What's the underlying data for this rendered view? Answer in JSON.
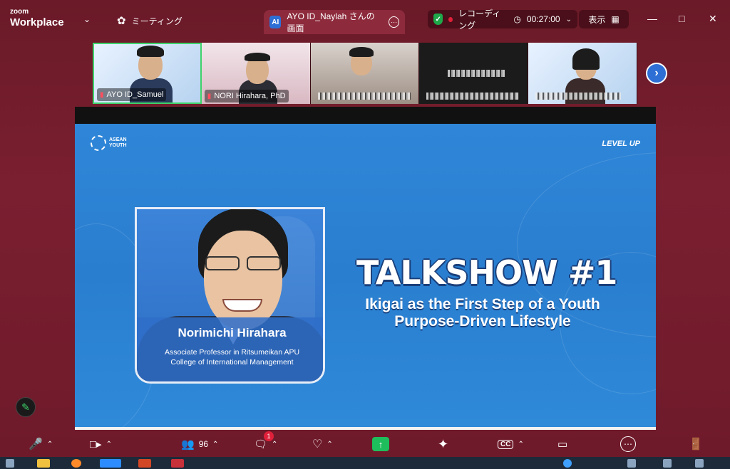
{
  "app": {
    "brand_small": "zoom",
    "brand_big": "Workplace",
    "meeting_label": "ミーティング"
  },
  "share_tab": {
    "badge": "AI",
    "label": "AYO ID_Naylah さんの画面"
  },
  "recording": {
    "label": "レコーディング",
    "timer": "00:27:00"
  },
  "view": {
    "label": "表示"
  },
  "participants": [
    {
      "name": "AYO ID_Samuel"
    },
    {
      "name": "NORI Hirahara, PhD"
    },
    {
      "name": ""
    },
    {
      "name": ""
    },
    {
      "name": ""
    }
  ],
  "slide": {
    "logo_line1": "ASEAN",
    "logo_line2": "YOUTH",
    "level_up": "LEVEL UP",
    "speaker_name": "Norimichi Hirahara",
    "speaker_role_line1": "Associate Professor in Ritsumeikan APU",
    "speaker_role_line2": "College of International Management",
    "title": "TALKSHOW #1",
    "subtitle_line1": "Ikigai as the First Step of a Youth",
    "subtitle_line2": "Purpose-Driven Lifestyle"
  },
  "toolbar": {
    "participant_count": "96",
    "chat_badge": "1",
    "cc_label": "CC"
  }
}
